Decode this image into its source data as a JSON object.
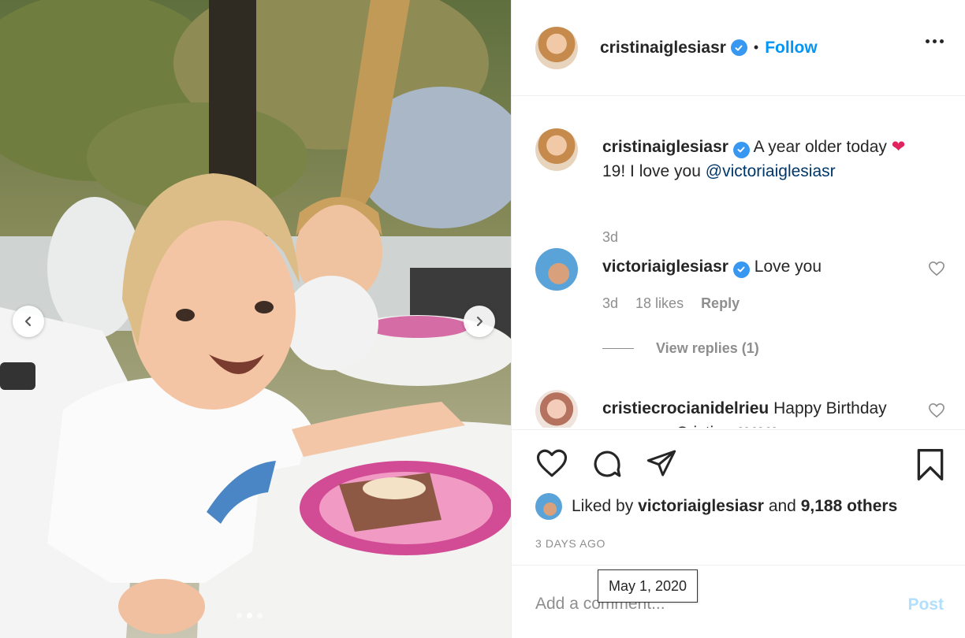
{
  "post": {
    "author": "cristinaiglesiasr",
    "separator": "•",
    "follow_label": "Follow"
  },
  "caption": {
    "username": "cristinaiglesiasr",
    "text_part1": "A year older today",
    "heart": "❤",
    "text_part2": "19! I love you",
    "mention": "@victoriaiglesiasr",
    "time": "3d"
  },
  "comments": [
    {
      "username": "victoriaiglesiasr",
      "text": "Love you",
      "time": "3d",
      "likes": "18 likes",
      "reply_label": "Reply",
      "view_replies": "View replies (1)"
    },
    {
      "username": "cristiecrocianidelrieu",
      "text": "Happy Birthday gorgeous Cristina ❤❤❤"
    }
  ],
  "liked_by": {
    "prefix": "Liked by",
    "user": "victoriaiglesiasr",
    "middle": "and",
    "others": "9,188 others"
  },
  "time_ago": "3 DAYS AGO",
  "tooltip": "May 1, 2020",
  "add_comment": {
    "placeholder": "Add a comment...",
    "post_label": "Post"
  },
  "carousel": {
    "slide_count": 3,
    "active_index": 1
  },
  "colors": {
    "accent": "#0095f6",
    "verified": "#3897f0",
    "heart": "#e0245e"
  },
  "icons": [
    "chevron-left-icon",
    "chevron-right-icon",
    "verified-badge-icon",
    "more-options-icon",
    "heart-outline-icon",
    "comment-icon",
    "share-icon",
    "bookmark-icon"
  ]
}
